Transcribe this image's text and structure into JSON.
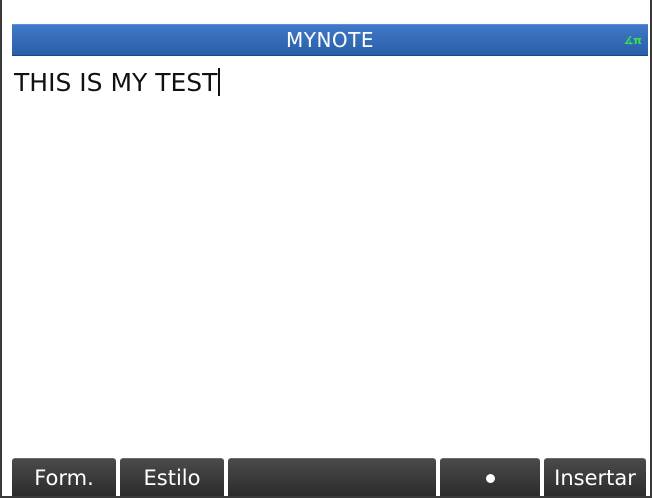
{
  "title_bar": {
    "title": "MYNOTE",
    "angle_mode_indicator": "∡π",
    "colors": {
      "background": "#2f66b3",
      "text": "#ffffff",
      "indicator": "#3ee04a"
    }
  },
  "note": {
    "text": "THIS IS MY TEST"
  },
  "menu": {
    "keys": [
      {
        "label": "Form."
      },
      {
        "label": "Estilo"
      },
      {
        "label": ""
      },
      {
        "label": "•",
        "icon": "bullet-icon"
      },
      {
        "label": "Insertar"
      }
    ]
  }
}
